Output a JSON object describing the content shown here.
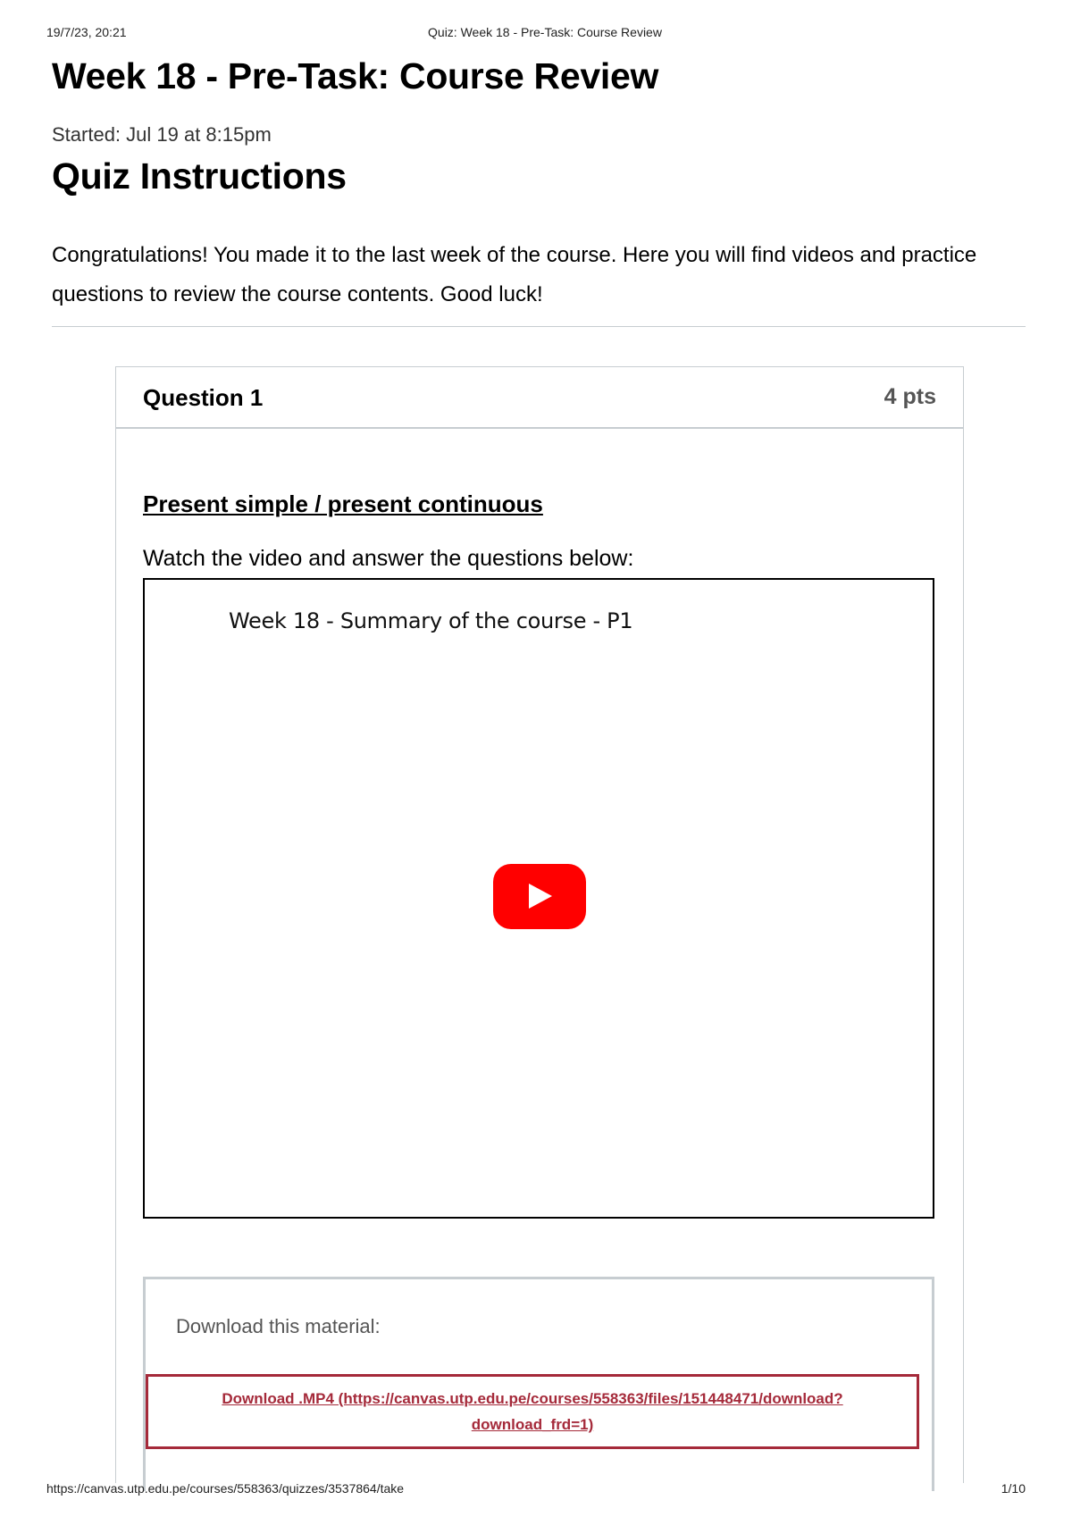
{
  "print_header": {
    "date": "19/7/23, 20:21",
    "title": "Quiz: Week 18 - Pre-Task: Course Review"
  },
  "page": {
    "title": "Week 18 - Pre-Task: Course Review",
    "started": "Started: Jul 19 at 8:15pm",
    "instructions_heading": "Quiz Instructions",
    "instructions_text": "Congratulations! You made it to the last week of the course. Here you will find videos and practice questions to review the course contents. Good luck!"
  },
  "question": {
    "name": "Question 1",
    "points": "4 pts",
    "topic": "Present simple / present continuous",
    "prompt": "Watch the video and answer the questions below:",
    "video": {
      "title": "Week 18 - Summary of the course - P1",
      "play_icon": "youtube-play-icon",
      "play_color": "#ff0000"
    },
    "download": {
      "label": "Download this material:",
      "link_line1": "Download .MP4 (https://canvas.utp.edu.pe/courses/558363/files/151448471/download?",
      "link_line2": "download_frd=1)",
      "link_color": "#a52a3a"
    }
  },
  "print_footer": {
    "url": "https://canvas.utp.edu.pe/courses/558363/quizzes/3537864/take",
    "page": "1/10"
  }
}
